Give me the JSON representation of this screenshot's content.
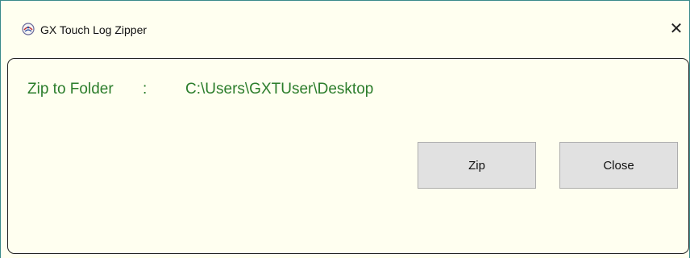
{
  "window": {
    "title": "GX Touch Log Zipper",
    "close_glyph": "✕"
  },
  "form": {
    "label": "Zip to Folder",
    "separator": ":",
    "path": "C:\\Users\\GXTUser\\Desktop"
  },
  "buttons": {
    "zip_label": "Zip",
    "close_label": "Close"
  },
  "icons": {
    "app": "app-logo-icon",
    "close": "close-icon"
  },
  "colors": {
    "background": "#fffff0",
    "label_text": "#2b7d2b",
    "button_face": "#e1e1e1"
  }
}
